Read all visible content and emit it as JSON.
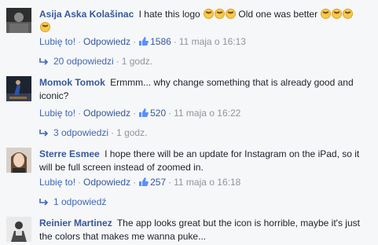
{
  "comments": [
    {
      "author": "Asija Aska Kolašinac",
      "text_a": "I hate this logo",
      "text_b": "Old one was better",
      "like_action": "Lubię to!",
      "reply_action": "Odpowiedz",
      "like_count": "1586",
      "timestamp": "11 maja o 16:13",
      "replies_label": "20 odpowiedzi",
      "replies_age": "1 godz."
    },
    {
      "author": "Momok Tomok",
      "text": "Ermmm... why change something that is already good and iconic?",
      "like_action": "Lubię to!",
      "reply_action": "Odpowiedz",
      "like_count": "520",
      "timestamp": "11 maja o 16:22",
      "replies_label": "3 odpowiedzi",
      "replies_age": "1 godz."
    },
    {
      "author": "Sterre Esmee",
      "text": "I hope there will be an update for Instagram on the iPad, so it will be full screen instead of zoomed in.",
      "like_action": "Lubię to!",
      "reply_action": "Odpowiedz",
      "like_count": "257",
      "timestamp": "11 maja o 16:18",
      "replies_label": "1 odpowiedź"
    },
    {
      "author": "Reinier Martinez",
      "text": "The app looks great but the icon is horrible, maybe it's just the colors that makes me wanna puke..."
    }
  ],
  "icons": {
    "like": "thumbs-up-icon",
    "reply_arrow": "reply-arrow-icon",
    "emoji": "angry-face-emoji-icon"
  },
  "colors": {
    "author": "#365899",
    "link": "#4267b2",
    "meta": "#90949c",
    "background": "#f6f7f9"
  }
}
